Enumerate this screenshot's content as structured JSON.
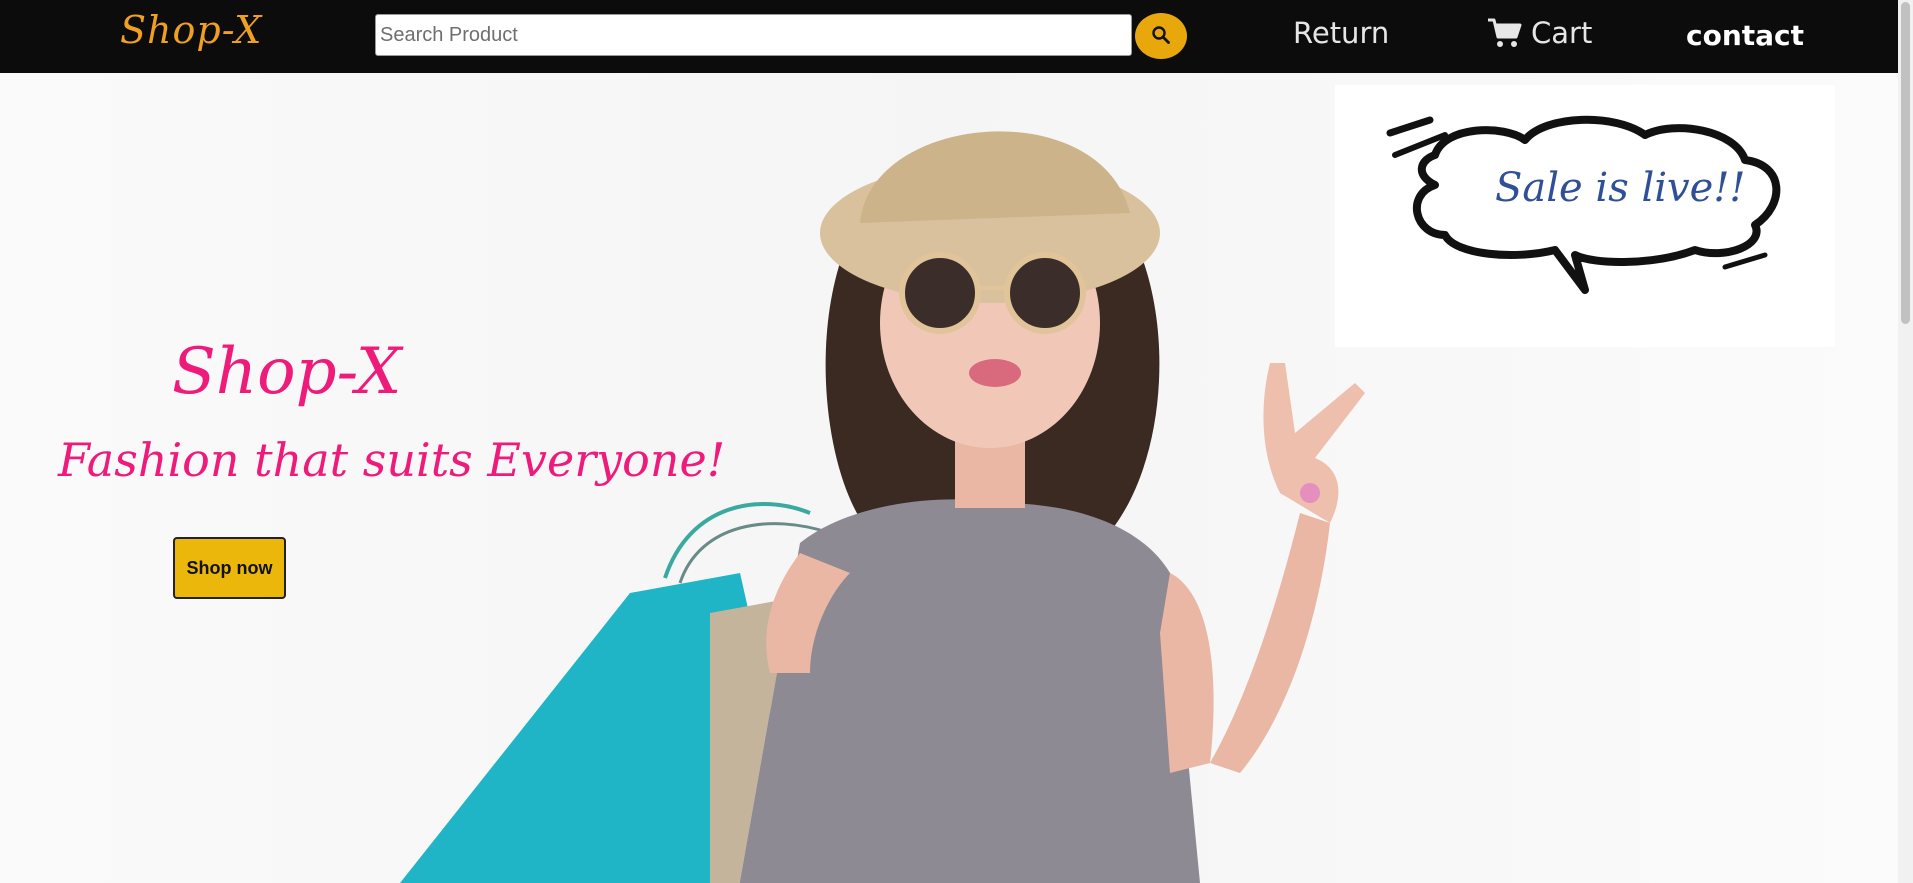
{
  "navbar": {
    "brand": "Shop-X",
    "search": {
      "placeholder": "Search Product",
      "value": ""
    },
    "links": {
      "return": "Return",
      "cart": "Cart",
      "contact": "contact"
    }
  },
  "hero": {
    "title": "Shop-X",
    "tagline": "Fashion that suits Everyone!",
    "cta_label": "Shop now",
    "sale_bubble": "Sale is live!!"
  },
  "icons": {
    "search": "search-icon",
    "cart": "cart-icon"
  },
  "colors": {
    "navbar_bg": "#0c0c0c",
    "brand_orange": "#f0a020",
    "accent_yellow": "#eab70a",
    "hero_pink": "#ee1b7a",
    "sale_blue": "#2f4f97"
  }
}
